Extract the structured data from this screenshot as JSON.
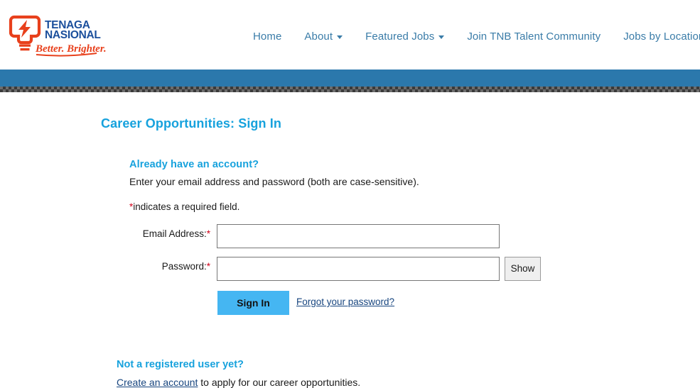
{
  "header": {
    "logo": {
      "name": "tenaga-nasional-logo",
      "line1": "TENAGA",
      "line2": "NASIONAL",
      "tagline": "Better. Brighter.",
      "mark_color": "#E8401C",
      "text_color": "#1B4F9C"
    },
    "nav": [
      {
        "label": "Home",
        "has_caret": false
      },
      {
        "label": "About",
        "has_caret": true
      },
      {
        "label": "Featured Jobs",
        "has_caret": true
      },
      {
        "label": "Join TNB Talent Community",
        "has_caret": false
      },
      {
        "label": "Jobs by Location",
        "has_caret": false
      }
    ],
    "band_color": "#2B78AC"
  },
  "page": {
    "title": "Career Opportunities: Sign In",
    "title_color": "#17A2DD"
  },
  "signin": {
    "heading": "Already have an account?",
    "subtext": "Enter your email address and password (both are case-sensitive).",
    "required_star": "*",
    "required_note": "indicates a required field.",
    "email_label": "Email Address:",
    "email_value": "",
    "email_placeholder": "",
    "password_label": "Password:",
    "password_value": "",
    "password_placeholder": "",
    "show_button": "Show",
    "submit_button": "Sign In",
    "forgot_link": "Forgot your password?",
    "accent_color": "#45B6F2"
  },
  "register": {
    "heading": "Not a registered user yet?",
    "link_text": "Create an account",
    "rest_text": " to apply for our career opportunities."
  }
}
